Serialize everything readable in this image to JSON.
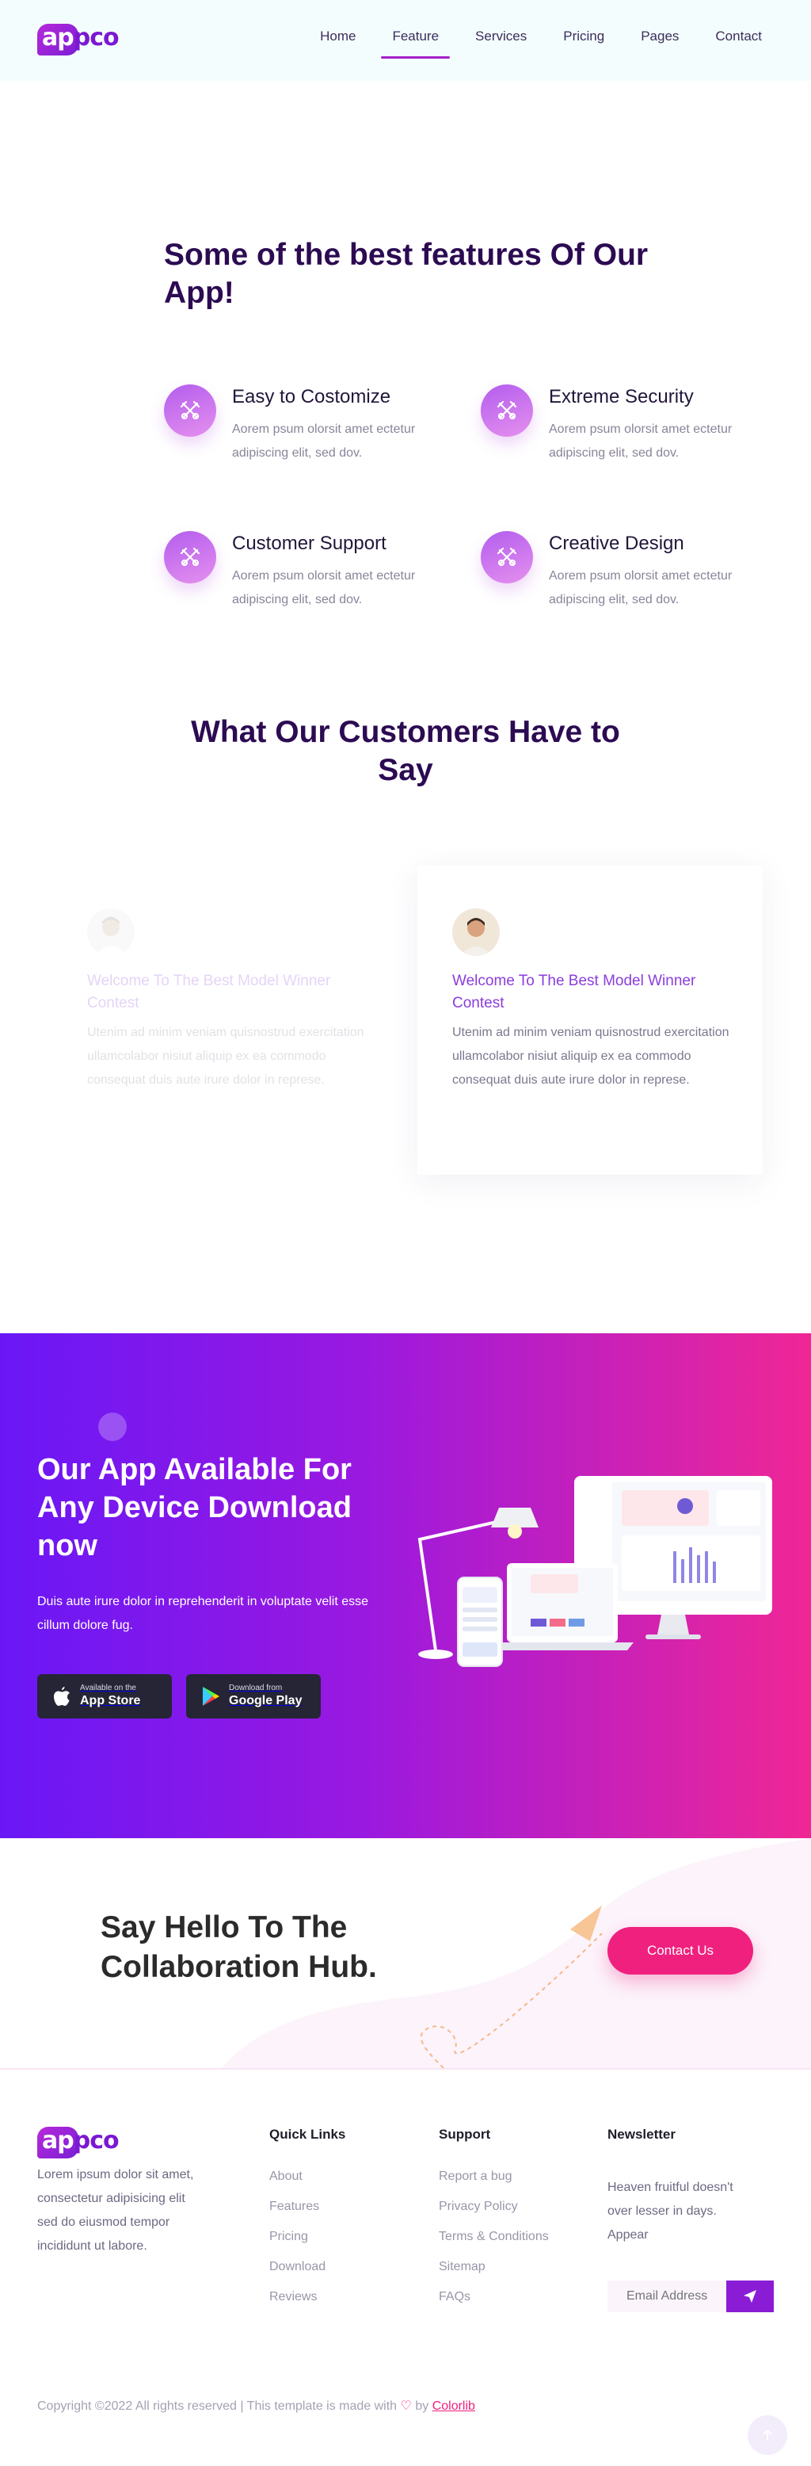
{
  "brand": {
    "logo_text_a": "ap",
    "logo_text_b": "pco"
  },
  "nav": {
    "items": [
      "Home",
      "Feature",
      "Services",
      "Pricing",
      "Pages",
      "Contact"
    ],
    "active_index": 1
  },
  "features": {
    "title": "Some of the best features Of Our App!",
    "items": [
      {
        "title": "Easy to Costomize",
        "desc": "Aorem psum olorsit amet ectetur adipiscing elit, sed dov.",
        "icon": "tools-icon"
      },
      {
        "title": "Extreme Security",
        "desc": "Aorem psum olorsit amet ectetur adipiscing elit, sed dov.",
        "icon": "tools-icon"
      },
      {
        "title": "Customer Support",
        "desc": "Aorem psum olorsit amet ectetur adipiscing elit, sed dov.",
        "icon": "tools-icon"
      },
      {
        "title": "Creative Design",
        "desc": "Aorem psum olorsit amet ectetur adipiscing elit, sed dov.",
        "icon": "tools-icon"
      }
    ]
  },
  "testimonials": {
    "title": "What Our Customers Have to Say",
    "items": [
      {
        "heading": "Welcome To The Best Model Winner Contest",
        "body": "Utenim ad minim veniam quisnostrud exercitation ullamcolabor nisiut aliquip ex ea commodo consequat duis aute irure dolor in represe."
      },
      {
        "heading": "Welcome To The Best Model Winner Contest",
        "body": "Utenim ad minim veniam quisnostrud exercitation ullamcolabor nisiut aliquip ex ea commodo consequat duis aute irure dolor in represe."
      }
    ]
  },
  "download": {
    "title": "Our App Available For Any Device Download now",
    "desc": "Duis aute irure dolor in reprehenderit in voluptate velit esse cillum dolore fug.",
    "app_store": {
      "small": "Available on the",
      "big": "App Store"
    },
    "google_play": {
      "small": "Download from",
      "big": "Google Play"
    }
  },
  "cta": {
    "title": "Say Hello To The Collaboration Hub.",
    "button": "Contact Us"
  },
  "footer": {
    "about": "Lorem ipsum dolor sit amet, consectetur adipisicing elit sed do eiusmod tempor incididunt ut labore.",
    "quick_links": {
      "title": "Quick Links",
      "items": [
        "About",
        "Features",
        "Pricing",
        "Download",
        "Reviews"
      ]
    },
    "support": {
      "title": "Support",
      "items": [
        "Report a bug",
        "Privacy Policy",
        "Terms & Conditions",
        "Sitemap",
        "FAQs"
      ]
    },
    "newsletter": {
      "title": "Newsletter",
      "desc": "Heaven fruitful doesn't over lesser in days. Appear",
      "placeholder": "Email Address"
    },
    "copyright_prefix": "Copyright ©2022 All rights reserved | This template is made with",
    "copyright_by": "by",
    "copyright_link": "Colorlib"
  },
  "colors": {
    "brand_purple": "#7b18d2",
    "accent_pink": "#f0207e",
    "title_dark": "#2c0b52",
    "gradient_start": "#6a17f6",
    "gradient_end": "#f02795"
  }
}
